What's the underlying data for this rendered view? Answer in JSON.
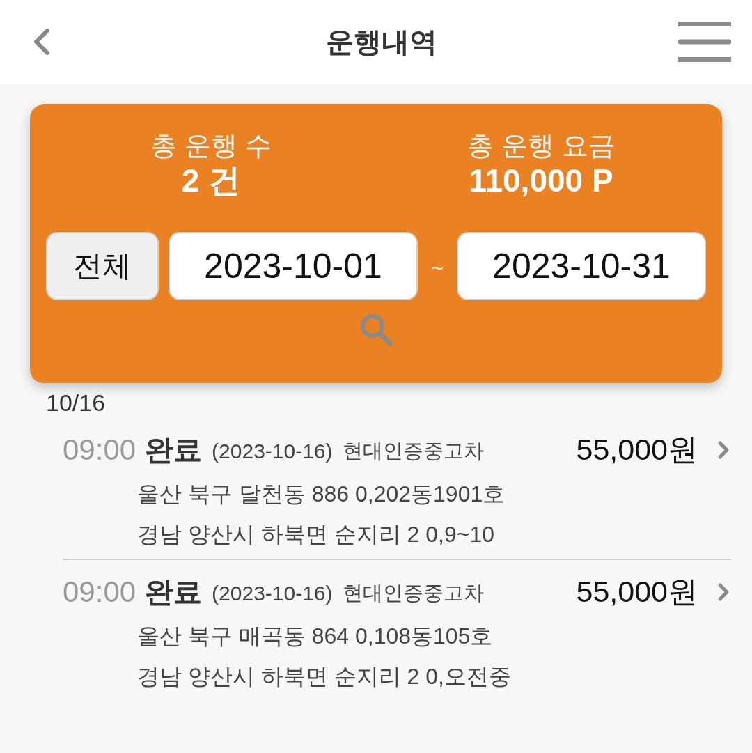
{
  "header": {
    "title": "운행내역"
  },
  "summary": {
    "stats": [
      {
        "label": "총 운행 수",
        "value": "2 건"
      },
      {
        "label": "총 운행 요금",
        "value": "110,000 P"
      }
    ],
    "filter": {
      "all_button": "전체",
      "start_date": "2023-10-01",
      "separator": "~",
      "end_date": "2023-10-31"
    }
  },
  "groups": [
    {
      "date": "10/16",
      "trips": [
        {
          "time": "09:00",
          "status": "완료",
          "date": "(2023-10-16)",
          "company": "현대인증중고차",
          "origin": "울산 북구 달천동 886 0,202동1901호",
          "destination": "경남 양산시 하북면 순지리 2 0,9~10",
          "fare": "55,000원"
        },
        {
          "time": "09:00",
          "status": "완료",
          "date": "(2023-10-16)",
          "company": "현대인증중고차",
          "origin": "울산 북구 매곡동 864 0,108동105호",
          "destination": "경남 양산시 하북면 순지리 2 0,오전중",
          "fare": "55,000원"
        }
      ]
    }
  ]
}
